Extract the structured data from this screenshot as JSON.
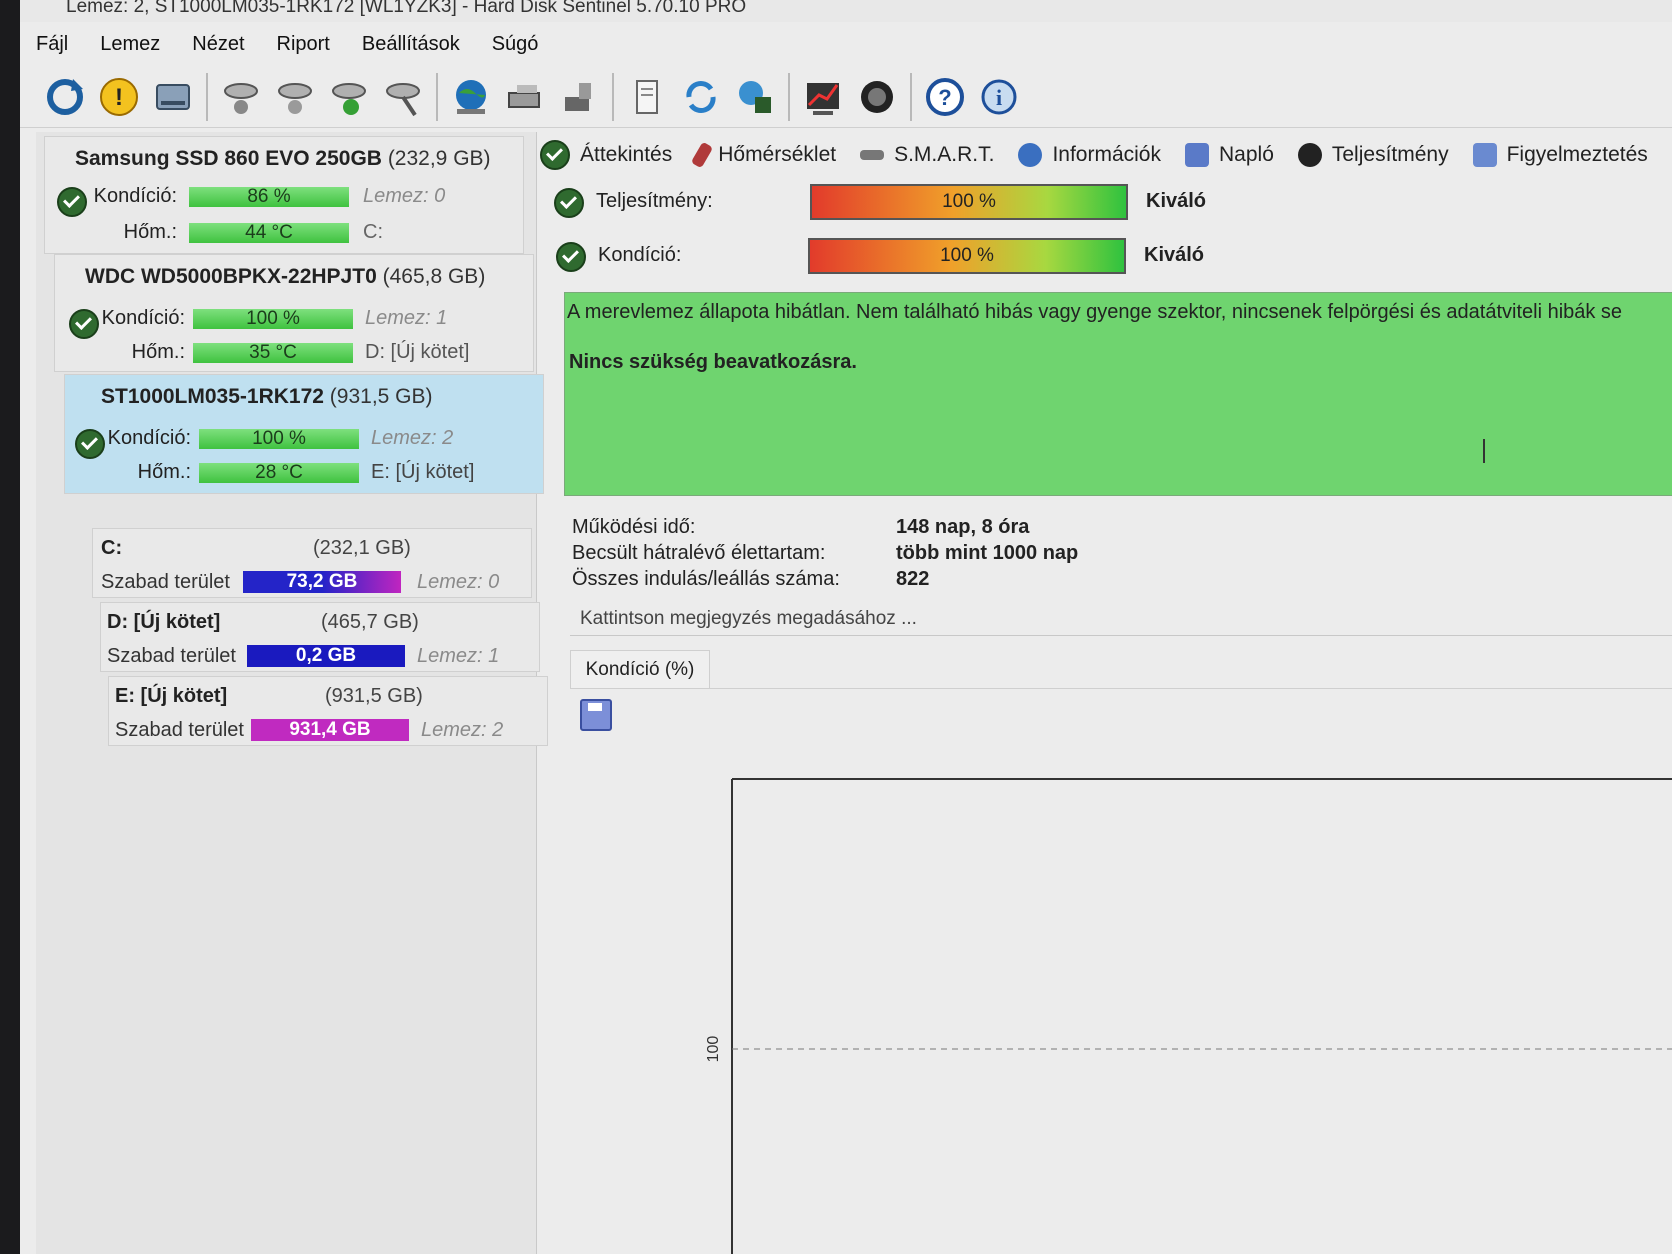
{
  "window": {
    "title": "Lemez: 2, ST1000LM035-1RK172 [WL1YZK3] - Hard Disk Sentinel 5.70.10 PRO"
  },
  "menu": [
    "Fájl",
    "Lemez",
    "Nézet",
    "Riport",
    "Beállítások",
    "Súgó"
  ],
  "toolbar_icons": [
    "refresh-icon",
    "warning-icon",
    "disk-icon",
    "surface-test-icon",
    "surface-test-icon-2",
    "surface-ok-icon",
    "disk-tool-icon",
    "globe-icon",
    "network-icon",
    "export-icon",
    "document-icon",
    "sync-icon",
    "monitor-icon",
    "chart-icon",
    "sound-icon",
    "help-icon",
    "info-icon"
  ],
  "disks": [
    {
      "name": "Samsung SSD 860 EVO 250GB",
      "capacity": "(232,9 GB)",
      "health_label": "Kondíció:",
      "health": "86 %",
      "health_value": 86,
      "temp_label": "Hőm.:",
      "temp": "44 °C",
      "disk_ref": "Lemez: 0",
      "volume": "C:"
    },
    {
      "name": "WDC WD5000BPKX-22HPJT0",
      "capacity": "(465,8 GB)",
      "health_label": "Kondíció:",
      "health": "100 %",
      "health_value": 100,
      "temp_label": "Hőm.:",
      "temp": "35 °C",
      "disk_ref": "Lemez: 1",
      "volume": "D: [Új kötet]"
    },
    {
      "name": "ST1000LM035-1RK172",
      "capacity": "(931,5 GB)",
      "health_label": "Kondíció:",
      "health": "100 %",
      "health_value": 100,
      "temp_label": "Hőm.:",
      "temp": "28 °C",
      "disk_ref": "Lemez: 2",
      "volume": "E: [Új kötet]"
    }
  ],
  "volumes": [
    {
      "name": "C:",
      "size": "(232,1 GB)",
      "free_label": "Szabad terület",
      "free": "73,2 GB",
      "disk_ref": "Lemez: 0",
      "color": "#2b2bd0"
    },
    {
      "name": "D: [Új kötet]",
      "size": "(465,7 GB)",
      "free_label": "Szabad terület",
      "free": "0,2 GB",
      "disk_ref": "Lemez: 1",
      "color": "#1a1abf"
    },
    {
      "name": "E: [Új kötet]",
      "size": "(931,5 GB)",
      "free_label": "Szabad terület",
      "free": "931,4 GB",
      "disk_ref": "Lemez: 2",
      "color": "#c02ac0"
    }
  ],
  "tabs": [
    "Áttekintés",
    "Hőmérséklet",
    "S.M.A.R.T.",
    "Információk",
    "Napló",
    "Teljesítmény",
    "Figyelmeztetés"
  ],
  "status": {
    "perf_label": "Teljesítmény:",
    "perf_value": "100 %",
    "perf_text": "Kiváló",
    "health_label": "Kondíció:",
    "health_value": "100 %",
    "health_text": "Kiváló"
  },
  "message": {
    "line1": "A merevlemez állapota hibátlan. Nem található hibás vagy gyenge szektor, nincsenek felpörgési és adatátviteli hibák se",
    "line2": "Nincs szükség beavatkozásra."
  },
  "info": [
    {
      "label": "Működési idő:",
      "value": "148 nap, 8 óra"
    },
    {
      "label": "Becsült hátralévő élettartam:",
      "value": "több mint 1000 nap"
    },
    {
      "label": "Összes indulás/leállás száma:",
      "value": "822"
    }
  ],
  "note_placeholder": "Kattintson megjegyzés megadásához ...",
  "chart_tab": "Kondíció  (%)",
  "chart_data": {
    "type": "line",
    "title": "",
    "xlabel": "",
    "ylabel": "",
    "y_ticks": [
      "100"
    ],
    "series": []
  }
}
